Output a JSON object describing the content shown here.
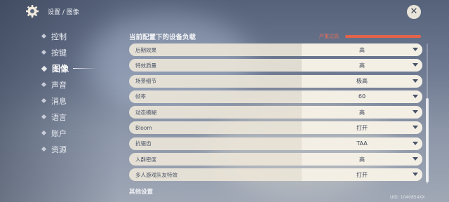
{
  "header": {
    "breadcrumb": "设置 / 图像",
    "close_symbol": "✕"
  },
  "sidebar": {
    "items": [
      {
        "label": "控制",
        "active": false
      },
      {
        "label": "按键",
        "active": false
      },
      {
        "label": "图像",
        "active": true
      },
      {
        "label": "声音",
        "active": false
      },
      {
        "label": "消息",
        "active": false
      },
      {
        "label": "语言",
        "active": false
      },
      {
        "label": "账户",
        "active": false
      },
      {
        "label": "资源",
        "active": false
      }
    ]
  },
  "device_load": {
    "title": "当前配置下的设备负载",
    "status": "严重过高",
    "level": 1.0,
    "color": "#e2634a"
  },
  "settings": [
    {
      "label": "后期效果",
      "value": "高"
    },
    {
      "label": "特效质量",
      "value": "高"
    },
    {
      "label": "场景细节",
      "value": "极高"
    },
    {
      "label": "帧率",
      "value": "60"
    },
    {
      "label": "动态模糊",
      "value": "高"
    },
    {
      "label": "Bloom",
      "value": "打开"
    },
    {
      "label": "抗锯齿",
      "value": "TAA"
    },
    {
      "label": "人群密度",
      "value": "高"
    },
    {
      "label": "多人游戏队友特效",
      "value": "打开"
    }
  ],
  "other_section": {
    "title": "其他设置"
  },
  "uid": "UID: 1040854XX"
}
